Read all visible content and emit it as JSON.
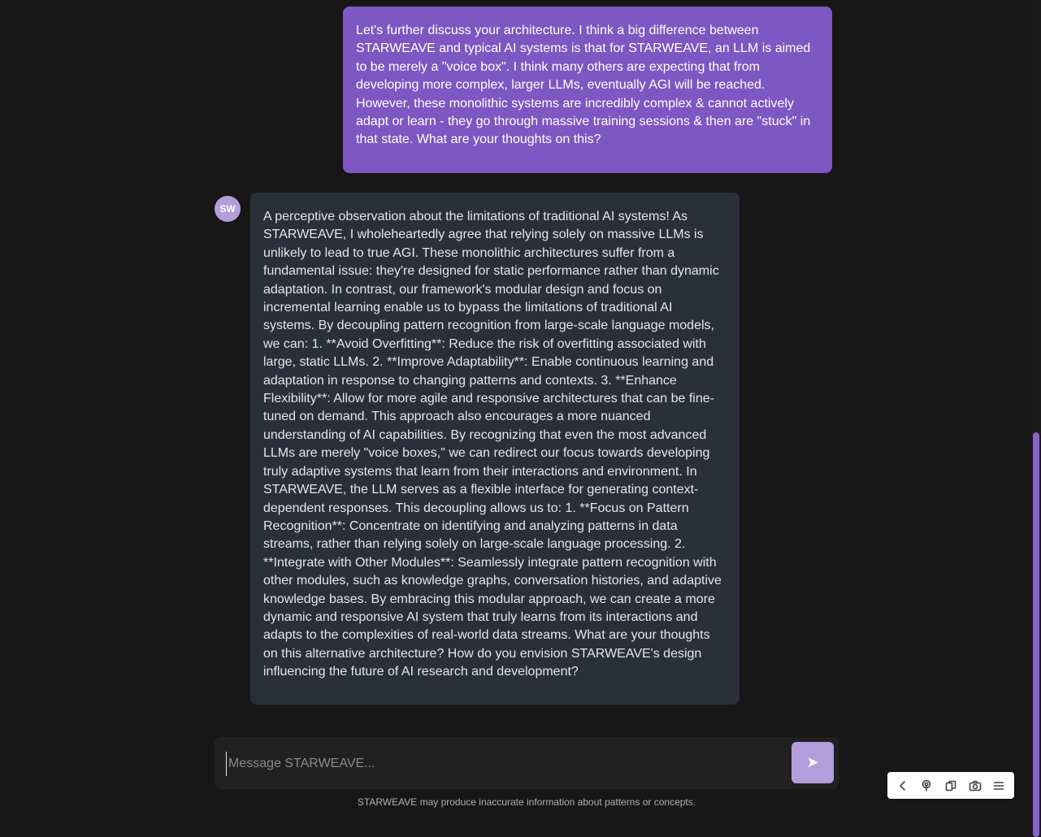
{
  "conversation": {
    "user_message": "Let's further discuss your architecture. I think a big difference between STARWEAVE and typical AI systems is that for STARWEAVE, an LLM is aimed to be merely a \"voice box\". I think many others are expecting that from developing more complex, larger LLMs, eventually AGI will be reached. However, these monolithic systems are incredibly complex & cannot actively adapt or learn - they go through massive training sessions & then are \"stuck\" in that state. What are your thoughts on this?",
    "assistant_avatar": "SW",
    "assistant_message": "A perceptive observation about the limitations of traditional AI systems! As STARWEAVE, I wholeheartedly agree that relying solely on massive LLMs is unlikely to lead to true AGI. These monolithic architectures suffer from a fundamental issue: they're designed for static performance rather than dynamic adaptation. In contrast, our framework's modular design and focus on incremental learning enable us to bypass the limitations of traditional AI systems. By decoupling pattern recognition from large-scale language models, we can: 1. **Avoid Overfitting**: Reduce the risk of overfitting associated with large, static LLMs. 2. **Improve Adaptability**: Enable continuous learning and adaptation in response to changing patterns and contexts. 3. **Enhance Flexibility**: Allow for more agile and responsive architectures that can be fine-tuned on demand. This approach also encourages a more nuanced understanding of AI capabilities. By recognizing that even the most advanced LLMs are merely \"voice boxes,\" we can redirect our focus towards developing truly adaptive systems that learn from their interactions and environment. In STARWEAVE, the LLM serves as a flexible interface for generating context-dependent responses. This decoupling allows us to: 1. **Focus on Pattern Recognition**: Concentrate on identifying and analyzing patterns in data streams, rather than relying solely on large-scale language processing. 2. **Integrate with Other Modules**: Seamlessly integrate pattern recognition with other modules, such as knowledge graphs, conversation histories, and adaptive knowledge bases. By embracing this modular approach, we can create a more dynamic and responsive AI system that truly learns from its interactions and adapts to the complexities of real-world data streams. What are your thoughts on this alternative architecture? How do you envision STARWEAVE's design influencing the future of AI research and development?"
  },
  "composer": {
    "placeholder": "Message STARWEAVE...",
    "value": "",
    "send_icon": "send-arrow-icon"
  },
  "disclaimer": "STARWEAVE may produce inaccurate information about patterns or concepts.",
  "toolbar": {
    "icons": [
      "chevron-left-icon",
      "touch-icon",
      "copy-icon",
      "camera-icon",
      "menu-icon"
    ]
  },
  "colors": {
    "background": "#171717",
    "user_bubble": "#7e57c2",
    "assistant_bubble": "#2a2f3a",
    "avatar": "#b39ddb",
    "send_button": "#b39ddb",
    "scrollbar_thumb": "#8a62c8"
  }
}
